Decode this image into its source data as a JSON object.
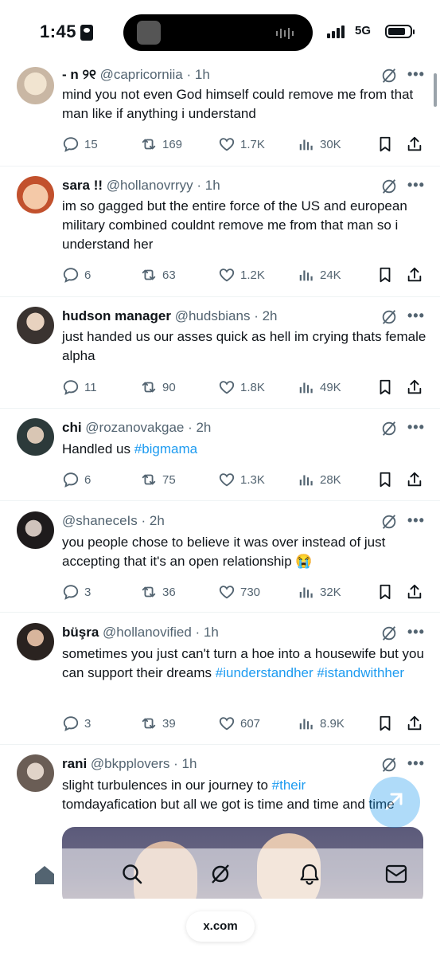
{
  "status_bar": {
    "time": "1:45",
    "network": "5G"
  },
  "tweets": [
    {
      "name": "- n ୨୧",
      "handle": "@capricorniia",
      "time": "1h",
      "text": "mind you not even God himself could remove me from that man like if anything i understand",
      "replies": "15",
      "reposts": "169",
      "likes": "1.7K",
      "views": "30K"
    },
    {
      "name": "sara !!",
      "handle": "@hollanovrryy",
      "time": "1h",
      "text": "im so gagged but the entire force of the US and european military combined couldnt remove me from that man so i understand her",
      "replies": "6",
      "reposts": "63",
      "likes": "1.2K",
      "views": "24K"
    },
    {
      "name": "hudson manager",
      "handle": "@hudsbians",
      "time": "2h",
      "text": "just handed us our asses quick as hell im crying thats female alpha",
      "replies": "11",
      "reposts": "90",
      "likes": "1.8K",
      "views": "49K"
    },
    {
      "name": "chi",
      "handle": "@rozanovakgae",
      "time": "2h",
      "text_before": "Handled us ",
      "hashtag": "#bigmama",
      "replies": "6",
      "reposts": "75",
      "likes": "1.3K",
      "views": "28K"
    },
    {
      "name": "",
      "handle": "@shaneceIs",
      "time": "2h",
      "text": "you people chose to believe it was over instead of just accepting that it's an open relationship 😭",
      "replies": "3",
      "reposts": "36",
      "likes": "730",
      "views": "32K"
    },
    {
      "name": "büşra",
      "handle": "@hollanovified",
      "time": "1h",
      "text_before": "sometimes you just can't turn a hoe into a housewife but you can support their dreams ",
      "hashtag": "#iunderstandher",
      "hashtag2": "#istandwithher",
      "replies": "3",
      "reposts": "39",
      "likes": "607",
      "views": "8.9K"
    },
    {
      "name": "rani",
      "handle": "@bkpplovers",
      "time": "1h",
      "text_before": "slight turbulences in our journey to ",
      "hashtag": "#their",
      "text_after": "tomdayafication but all we got is time and time and time"
    }
  ],
  "browser": {
    "url": "x.com"
  },
  "icons": [
    "reply-icon",
    "repost-icon",
    "like-icon",
    "views-icon",
    "bookmark-icon",
    "share-icon",
    "grok-icon",
    "more-icon",
    "home-icon",
    "search-icon",
    "notifications-icon",
    "messages-icon"
  ],
  "colors": {
    "accent": "#1d9bf0",
    "text": "#0f1419",
    "muted": "#536471"
  }
}
